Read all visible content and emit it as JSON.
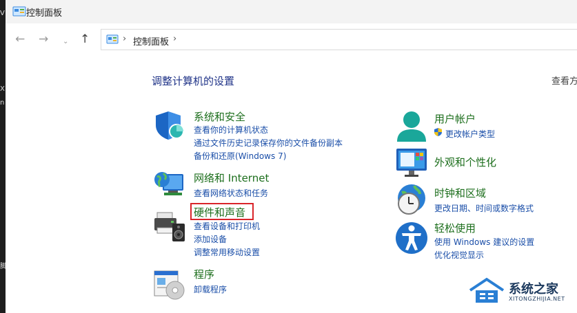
{
  "window": {
    "title": "控制面板"
  },
  "nav": {
    "back": "←",
    "forward": "→",
    "recent": "⌄",
    "up": "↑"
  },
  "address": {
    "separator": "›",
    "crumb": "控制面板"
  },
  "heading": "调整计算机的设置",
  "view_by_label": "查看方",
  "categories": [
    {
      "icon": "security-shield-icon",
      "title": "系统和安全",
      "links": [
        "查看你的计算机状态",
        "通过文件历史记录保存你的文件备份副本",
        "备份和还原(Windows 7)"
      ]
    },
    {
      "icon": "network-globe-icon",
      "title": "网络和 Internet",
      "links": [
        "查看网络状态和任务"
      ]
    },
    {
      "icon": "printer-speaker-icon",
      "title": "硬件和声音",
      "links": [
        "查看设备和打印机",
        "添加设备",
        "调整常用移动设置"
      ]
    },
    {
      "icon": "programs-disc-icon",
      "title": "程序",
      "links": [
        "卸载程序"
      ]
    },
    {
      "icon": "user-account-icon",
      "title": "用户帐户",
      "links": [
        "更改帐户类型"
      ]
    },
    {
      "icon": "appearance-monitor-icon",
      "title": "外观和个性化",
      "links": []
    },
    {
      "icon": "clock-globe-icon",
      "title": "时钟和区域",
      "links": [
        "更改日期、时间或数字格式"
      ]
    },
    {
      "icon": "accessibility-icon",
      "title": "轻松使用",
      "links": [
        "使用 Windows 建议的设置",
        "优化视觉显示"
      ]
    }
  ],
  "watermark": {
    "text": "系统之家",
    "url": "XITONGZHIJIA.NET"
  },
  "left_strip": {
    "a": "V",
    "b": "X",
    "c": "n",
    "d": "脚"
  },
  "colors": {
    "category_title": "#1c6e1c",
    "link": "#1a4ea8",
    "heading": "#1e3287",
    "highlight_border": "#d9242a"
  }
}
